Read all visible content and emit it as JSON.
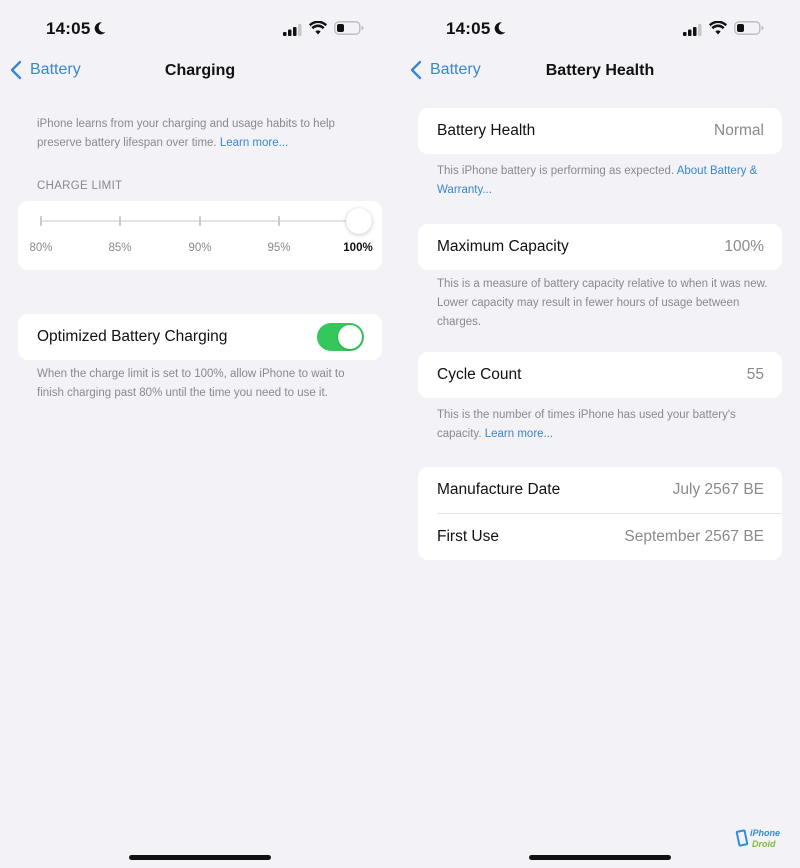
{
  "status_bar": {
    "time": "14:05"
  },
  "left_screen": {
    "nav": {
      "back_label": "Battery",
      "title": "Charging"
    },
    "intro": {
      "text": "iPhone learns from your charging and usage habits to help preserve battery lifespan over time. ",
      "link": "Learn more..."
    },
    "charge_limit": {
      "header": "CHARGE LIMIT",
      "ticks": [
        "80%",
        "85%",
        "90%",
        "95%",
        "100%"
      ],
      "selected": "100%",
      "selected_index": 4
    },
    "optimized": {
      "label": "Optimized Battery Charging",
      "enabled": true,
      "footer": "When the charge limit is set to 100%, allow iPhone to wait to finish charging past 80% until the time you need to use it."
    }
  },
  "right_screen": {
    "nav": {
      "back_label": "Battery",
      "title": "Battery Health"
    },
    "health": {
      "label": "Battery Health",
      "value": "Normal",
      "footer": "This iPhone battery is performing as expected. ",
      "footer_link": "About Battery & Warranty..."
    },
    "capacity": {
      "label": "Maximum Capacity",
      "value": "100%",
      "footer": "This is a measure of battery capacity relative to when it was new. Lower capacity may result in fewer hours of usage between charges."
    },
    "cycle": {
      "label": "Cycle Count",
      "value": "55",
      "footer": "This is the number of times iPhone has used your battery's capacity. ",
      "footer_link": "Learn more..."
    },
    "dates": [
      {
        "label": "Manufacture Date",
        "value": "July 2567 BE"
      },
      {
        "label": "First Use",
        "value": "September 2567 BE"
      }
    ]
  },
  "watermark": {
    "line1": "iPhone",
    "line2": "Droid"
  },
  "colors": {
    "accent": "#3a86d0",
    "toggle_on": "#34c759",
    "background": "#f2f2f7",
    "secondary_text": "#8a8a8e"
  }
}
